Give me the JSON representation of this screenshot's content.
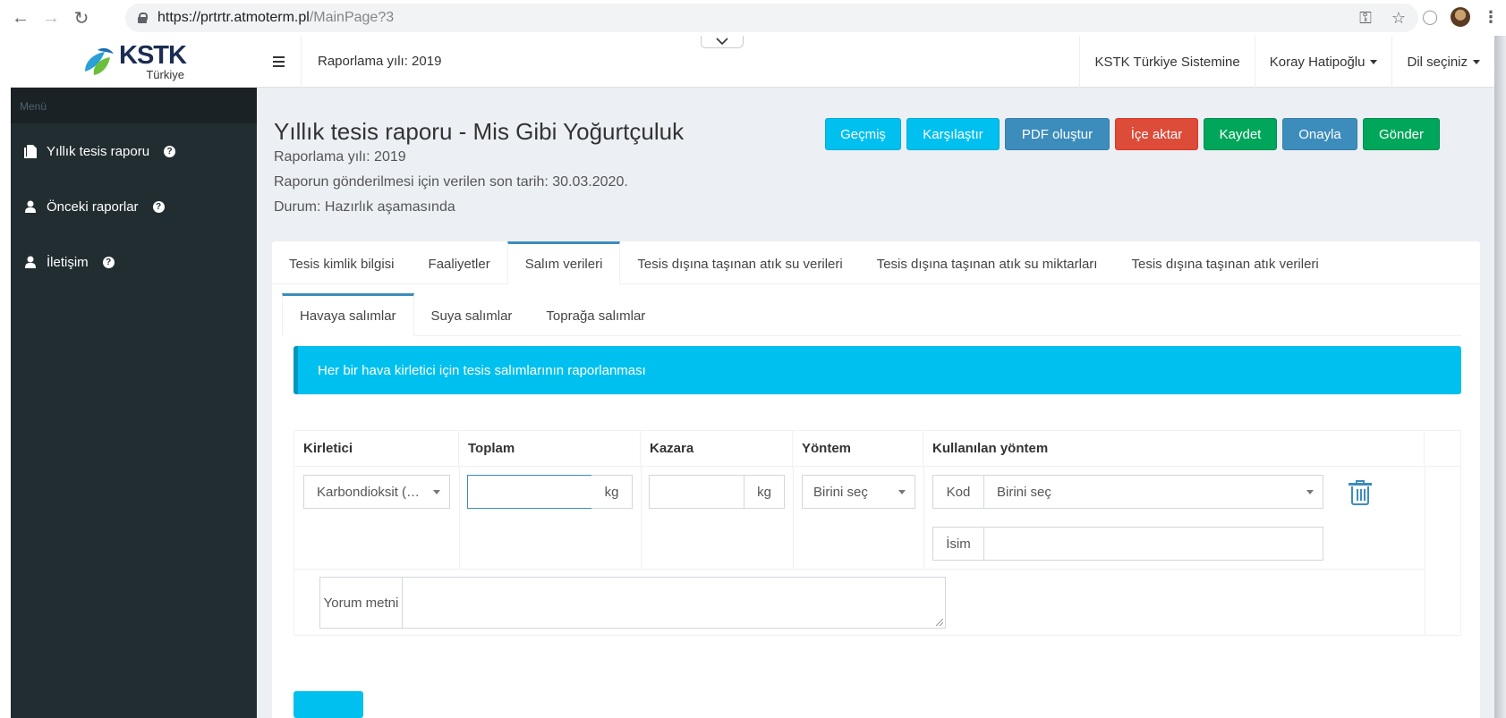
{
  "browser": {
    "url_base": "https://prtrtr.atmoterm.pl",
    "url_path": "/MainPage?3"
  },
  "logo": {
    "main": "KSTK",
    "sub": "Türkiye"
  },
  "sidebar": {
    "header": "Menü",
    "items": [
      {
        "label": "Yıllık tesis raporu",
        "icon": "document-icon"
      },
      {
        "label": "Önceki raporlar",
        "icon": "user-icon"
      },
      {
        "label": "İletişim",
        "icon": "user-icon"
      }
    ]
  },
  "topbar": {
    "report_year": "Raporlama yılı: 2019",
    "system_link": "KSTK Türkiye Sistemine",
    "user": "Koray Hatipoğlu",
    "language": "Dil seçiniz"
  },
  "page": {
    "title": "Yıllık tesis raporu - Mis Gibi Yoğurtçuluk",
    "year_line": "Raporlama yılı: 2019",
    "deadline_line": "Raporun gönderilmesi için verilen son tarih: 30.03.2020.",
    "status_line": "Durum: Hazırlık aşamasında"
  },
  "actions": {
    "history": "Geçmiş",
    "compare": "Karşılaştır",
    "pdf": "PDF oluştur",
    "import": "İçe aktar",
    "save": "Kaydet",
    "approve": "Onayla",
    "send": "Gönder"
  },
  "tabs": [
    "Tesis kimlik bilgisi",
    "Faaliyetler",
    "Salım verileri",
    "Tesis dışına taşınan atık su verileri",
    "Tesis dışına taşınan atık su miktarları",
    "Tesis dışına taşınan atık verileri"
  ],
  "subtabs": [
    "Havaya salımlar",
    "Suya salımlar",
    "Toprağa salımlar"
  ],
  "callout": "Her bir hava kirletici için tesis salımlarının raporlanması",
  "table": {
    "headers": {
      "pollutant": "Kirletici",
      "total": "Toplam",
      "accidental": "Kazara",
      "method": "Yöntem",
      "used_method": "Kullanılan yöntem"
    },
    "row": {
      "pollutant_value": "Karbondioksit (…",
      "total_value": "",
      "total_unit": "kg",
      "accidental_value": "",
      "accidental_unit": "kg",
      "method_value": "Birini seç",
      "code_label": "Kod",
      "code_value": "Birini seç",
      "name_label": "İsim",
      "name_value": "",
      "comment_label": "Yorum metni",
      "comment_value": ""
    }
  },
  "colors": {
    "sidebar_bg": "#222d32",
    "info": "#00c0ef",
    "primary": "#3c8dbc",
    "danger": "#dd4b39",
    "success": "#00a65a"
  }
}
